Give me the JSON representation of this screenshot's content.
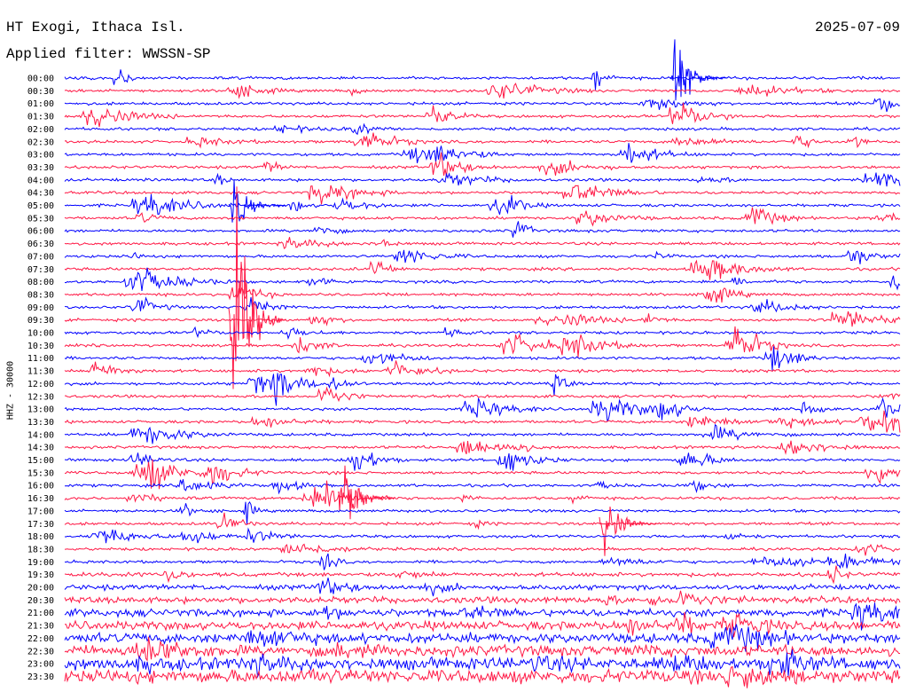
{
  "header": {
    "station": "HT Exogi, Ithaca Isl.",
    "filter": "Applied filter: WWSSN-SP",
    "date": "2025-07-09"
  },
  "chart_data": {
    "type": "line",
    "title": "HT Exogi, Ithaca Isl.",
    "subtitle": "Applied filter: WWSSN-SP",
    "ylabel": "HHZ - 30000",
    "colors": {
      "a": "#0000ff",
      "b": "#ff1744"
    },
    "rows": [
      "00:00",
      "00:30",
      "01:00",
      "01:30",
      "02:00",
      "02:30",
      "03:00",
      "03:30",
      "04:00",
      "04:30",
      "05:00",
      "05:30",
      "06:00",
      "06:30",
      "07:00",
      "07:30",
      "08:00",
      "08:30",
      "09:00",
      "09:30",
      "10:00",
      "10:30",
      "11:00",
      "11:30",
      "12:00",
      "12:30",
      "13:00",
      "13:30",
      "14:00",
      "14:30",
      "15:00",
      "15:30",
      "16:00",
      "16:30",
      "17:00",
      "17:30",
      "18:00",
      "18:30",
      "19:00",
      "19:30",
      "20:00",
      "20:30",
      "21:00",
      "21:30",
      "22:00",
      "22:30",
      "23:00",
      "23:30"
    ],
    "event_traces": [
      {
        "start": "00:00",
        "amplitude": 85
      },
      {
        "start": "05:00",
        "amplitude": 55
      },
      {
        "start": "09:30",
        "amplitude": 260
      },
      {
        "start": "16:30",
        "amplitude": 90
      },
      {
        "start": "17:30",
        "amplitude": 70
      }
    ]
  }
}
